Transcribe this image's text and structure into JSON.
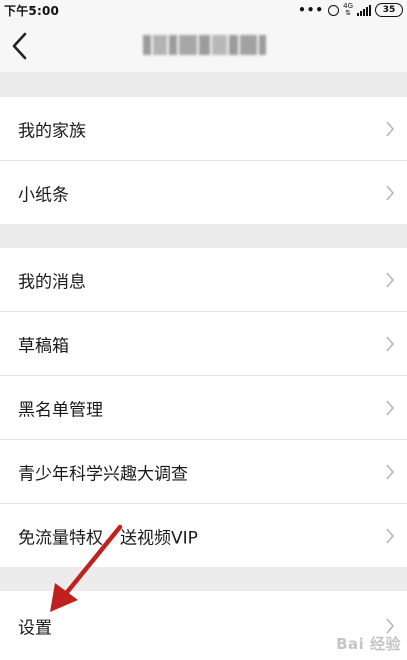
{
  "status_bar": {
    "time": "下午5:00",
    "network": "4G",
    "battery": "35",
    "icons": [
      "more-dots-icon",
      "alarm-icon",
      "signal-icon",
      "battery-icon"
    ]
  },
  "nav": {
    "back_icon": "chevron-left-icon",
    "title_blurred": true
  },
  "menu": {
    "section1": [
      {
        "label": "我的家族"
      },
      {
        "label": "小纸条"
      }
    ],
    "section2": [
      {
        "label": "我的消息"
      },
      {
        "label": "草稿箱"
      },
      {
        "label": "黑名单管理"
      },
      {
        "label": "青少年科学兴趣大调查"
      },
      {
        "label": "免流量特权，送视频VIP"
      }
    ],
    "section3": [
      {
        "label": "设置"
      }
    ]
  },
  "annotation": {
    "arrow_color": "#c0201e",
    "points_to": "设置"
  },
  "watermark": {
    "text": "Bai 经验"
  },
  "colors": {
    "background": "#ececec",
    "row": "#ffffff",
    "chevron": "#b5b5b5"
  }
}
